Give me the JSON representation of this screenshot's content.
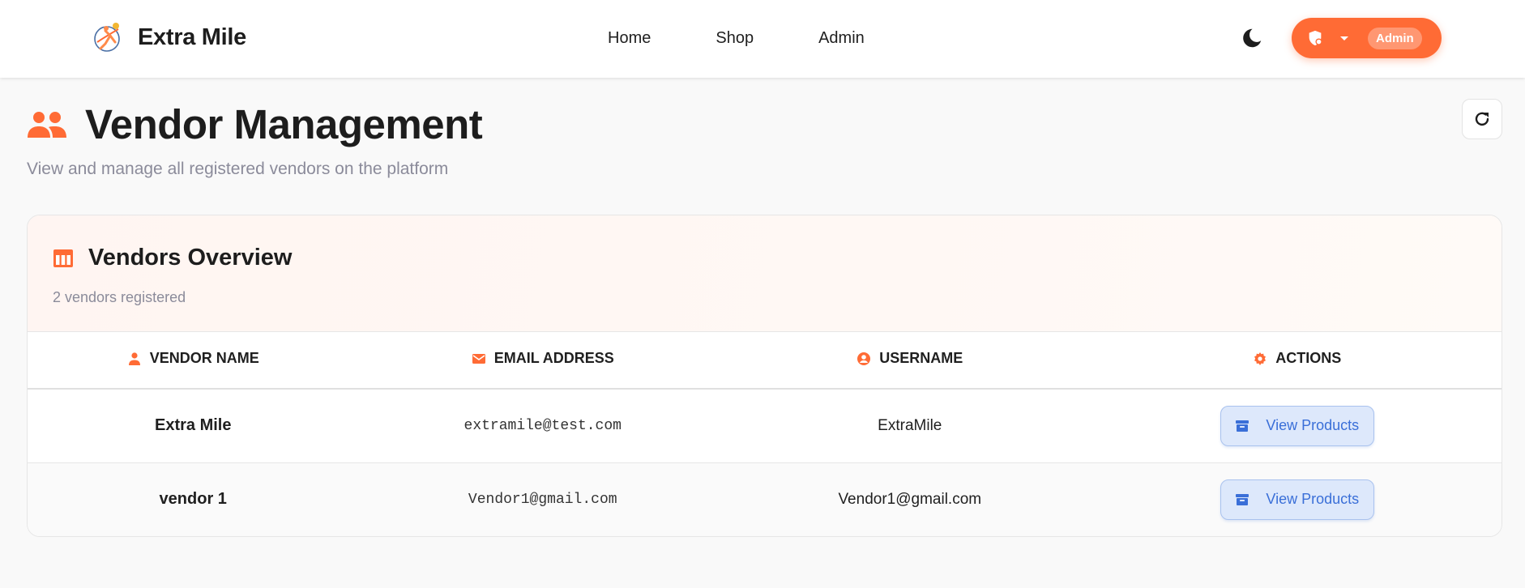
{
  "header": {
    "brand_name": "Extra Mile",
    "nav": [
      {
        "label": "Home"
      },
      {
        "label": "Shop"
      },
      {
        "label": "Admin"
      }
    ],
    "theme_icon": "moon-icon",
    "user_menu": {
      "badge": "Admin",
      "icon": "shield-icon",
      "caret": "caret-down-icon"
    }
  },
  "page": {
    "title": "Vendor Management",
    "subtitle": "View and manage all registered vendors on the platform",
    "title_icon": "people-icon",
    "refresh_icon": "refresh-icon"
  },
  "card": {
    "title": "Vendors Overview",
    "count_text": "2 vendors registered",
    "icon": "table-icon"
  },
  "table": {
    "headers": [
      {
        "label": "VENDOR NAME",
        "icon": "person-icon"
      },
      {
        "label": "EMAIL ADDRESS",
        "icon": "mail-icon"
      },
      {
        "label": "USERNAME",
        "icon": "account-circle-icon"
      },
      {
        "label": "ACTIONS",
        "icon": "gear-icon"
      }
    ],
    "rows": [
      {
        "name": "Extra Mile",
        "email": "extramile@test.com",
        "username": "ExtraMile",
        "action": "View Products"
      },
      {
        "name": "vendor 1",
        "email": "Vendor1@gmail.com",
        "username": "Vendor1@gmail.com",
        "action": "View Products"
      }
    ]
  },
  "colors": {
    "accent": "#ff6b35",
    "action_blue": "#3a6fd8",
    "action_bg": "#dde8fb",
    "muted_text": "#8b8b9a"
  }
}
